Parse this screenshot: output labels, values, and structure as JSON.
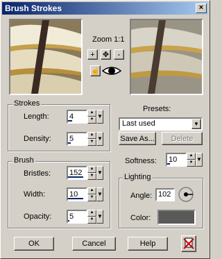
{
  "window": {
    "title": "Brush Strokes",
    "close_glyph": "×"
  },
  "zoom": {
    "label": "Zoom 1:1",
    "zoom_in_glyph": "+",
    "pan_glyph": "✥",
    "zoom_out_glyph": "-",
    "hand_glyph": "☝"
  },
  "strokes": {
    "group_label": "Strokes",
    "length_label": "Length:",
    "length_value": "4",
    "density_label": "Density:",
    "density_value": "5"
  },
  "brush": {
    "group_label": "Brush",
    "bristles_label": "Bristles:",
    "bristles_value": "152",
    "width_label": "Width:",
    "width_value": "10",
    "opacity_label": "Opacity:",
    "opacity_value": "5"
  },
  "presets": {
    "label": "Presets:",
    "selected": "Last used",
    "save_as_label": "Save As...",
    "delete_label": "Delete"
  },
  "softness": {
    "label": "Softness:",
    "value": "10"
  },
  "lighting": {
    "group_label": "Lighting",
    "angle_label": "Angle:",
    "angle_value": "102",
    "color_label": "Color:",
    "color_value": "#595959"
  },
  "footer": {
    "ok_label": "OK",
    "cancel_label": "Cancel",
    "help_label": "Help"
  },
  "colors": {
    "titlebar_start": "#0a246a",
    "titlebar_end": "#a6caf0",
    "face": "#d4d0c8"
  }
}
